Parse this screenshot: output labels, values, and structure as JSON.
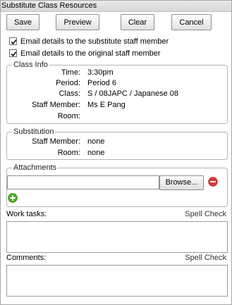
{
  "window": {
    "title": "Substitute Class Resources"
  },
  "toolbar": {
    "save_label": "Save",
    "preview_label": "Preview",
    "clear_label": "Clear",
    "cancel_label": "Cancel"
  },
  "options": {
    "email_substitute": {
      "label": "Email details to the substitute staff member",
      "checked": true
    },
    "email_original": {
      "label": "Email details to the original staff member",
      "checked": true
    }
  },
  "class_info": {
    "legend": "Class Info",
    "time_label": "Time:",
    "time_value": "3:30pm",
    "period_label": "Period:",
    "period_value": "Period 6",
    "class_label": "Class:",
    "class_value": "S / 08JAPC / Japanese 08",
    "staff_label": "Staff Member:",
    "staff_value": "Ms E Pang",
    "room_label": "Room:",
    "room_value": ""
  },
  "substitution": {
    "legend": "Substitution",
    "staff_label": "Staff Member:",
    "staff_value": "none",
    "room_label": "Room:",
    "room_value": "none"
  },
  "attachments": {
    "legend": "Attachments",
    "file_value": "",
    "browse_label": "Browse...",
    "remove_icon": "remove-circle-icon",
    "add_icon": "add-circle-icon"
  },
  "work_tasks": {
    "label": "Work tasks:",
    "spell_check": "Spell Check",
    "value": ""
  },
  "comments": {
    "label": "Comments:",
    "spell_check": "Spell Check",
    "value": ""
  },
  "colors": {
    "remove": "#d83a3a",
    "add": "#4caf1f"
  }
}
